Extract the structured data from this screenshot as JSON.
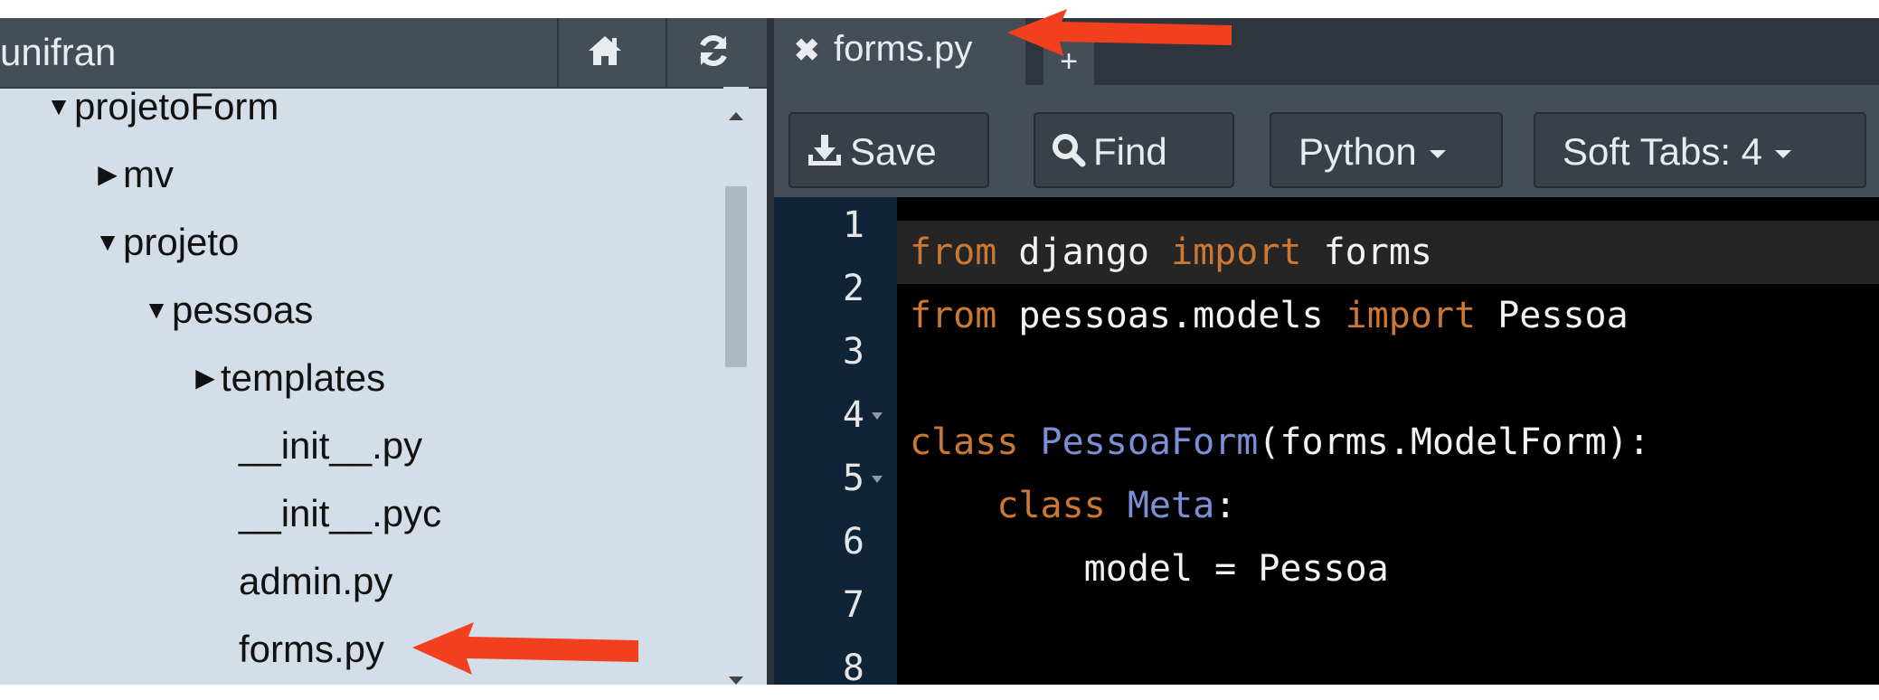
{
  "sidebar": {
    "project_name": "unifran",
    "icons": {
      "home": "home-icon",
      "refresh": "refresh-icon"
    },
    "tree": [
      {
        "label": "projetoForm",
        "caret": "expanded"
      },
      {
        "label": "mv",
        "caret": "collapsed"
      },
      {
        "label": "projeto",
        "caret": "expanded"
      },
      {
        "label": "pessoas",
        "caret": "expanded"
      },
      {
        "label": "templates",
        "caret": "collapsed"
      },
      {
        "label": "__init__.py",
        "caret": "none"
      },
      {
        "label": "__init__.pyc",
        "caret": "none"
      },
      {
        "label": "admin.py",
        "caret": "none"
      },
      {
        "label": "forms.py",
        "caret": "none"
      }
    ]
  },
  "editor": {
    "tabs": [
      {
        "label": "forms.py",
        "active": true
      }
    ],
    "new_tab_label": "+",
    "toolbar": {
      "save_label": "Save",
      "find_label": "Find",
      "language": "Python",
      "indent": "Soft Tabs: 4"
    },
    "line_numbers": [
      "1",
      "2",
      "3",
      "4",
      "5",
      "6",
      "7",
      "8"
    ],
    "code": [
      {
        "parts": [
          {
            "t": "from",
            "c": "kw"
          },
          {
            "t": " django ",
            "c": "plain"
          },
          {
            "t": "import",
            "c": "kw"
          },
          {
            "t": " forms",
            "c": "plain"
          }
        ]
      },
      {
        "parts": [
          {
            "t": "from",
            "c": "kw"
          },
          {
            "t": " pessoas.models ",
            "c": "plain"
          },
          {
            "t": "import",
            "c": "kw"
          },
          {
            "t": " Pessoa",
            "c": "plain"
          }
        ]
      },
      {
        "parts": []
      },
      {
        "parts": [
          {
            "t": "class",
            "c": "kw"
          },
          {
            "t": " ",
            "c": "plain"
          },
          {
            "t": "PessoaForm",
            "c": "cls"
          },
          {
            "t": "(forms.ModelForm):",
            "c": "plain"
          }
        ]
      },
      {
        "parts": [
          {
            "t": "    ",
            "c": "plain"
          },
          {
            "t": "class",
            "c": "kw"
          },
          {
            "t": " ",
            "c": "plain"
          },
          {
            "t": "Meta",
            "c": "cls"
          },
          {
            "t": ":",
            "c": "plain"
          }
        ]
      },
      {
        "parts": [
          {
            "t": "        model = Pessoa",
            "c": "plain"
          }
        ]
      },
      {
        "parts": []
      },
      {
        "parts": []
      }
    ]
  },
  "colors": {
    "keyword": "#cc7833",
    "class_name": "#7b8fd6",
    "annotation_arrow": "#f2401f"
  }
}
